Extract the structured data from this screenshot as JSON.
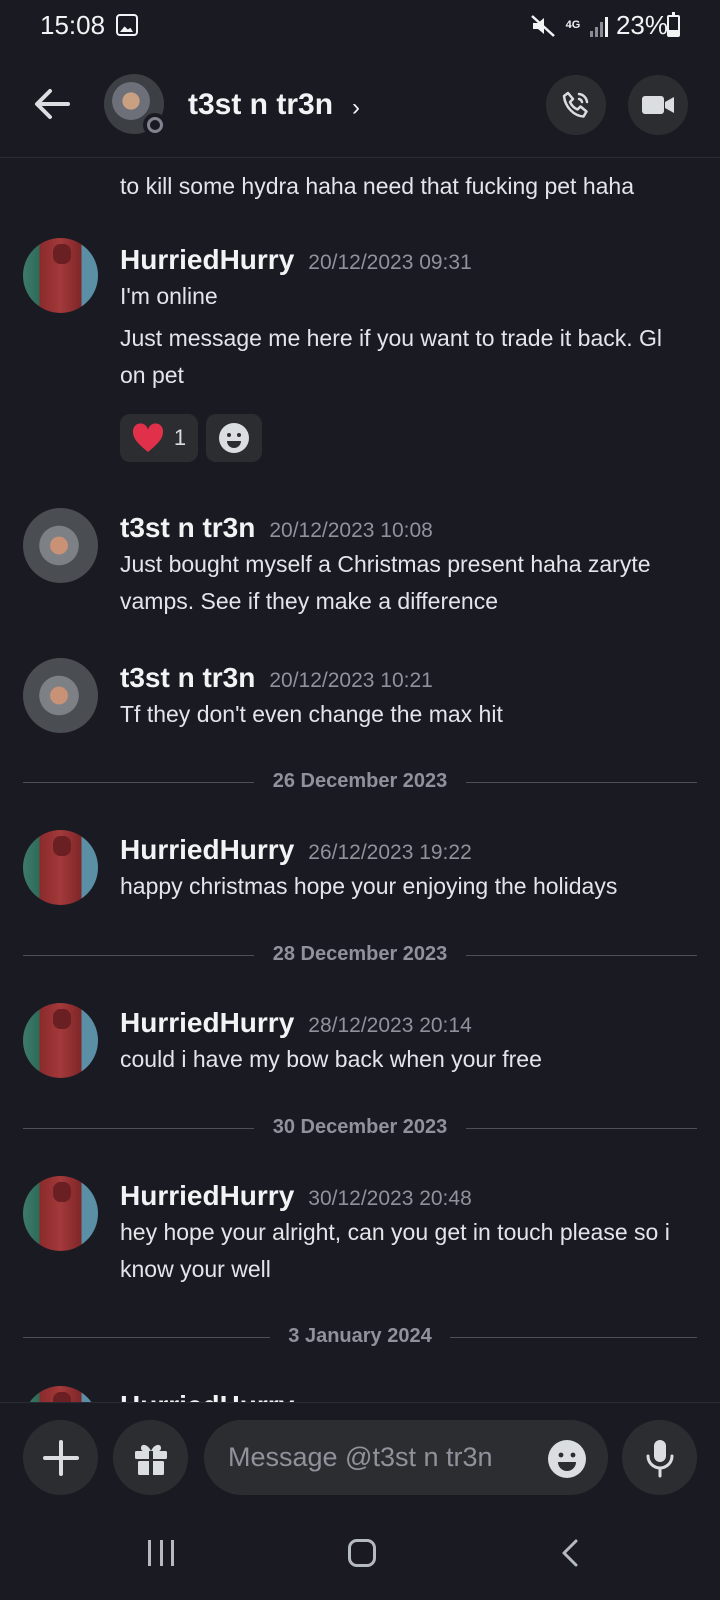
{
  "status_bar": {
    "time": "15:08",
    "network": "4G",
    "battery": "23%"
  },
  "header": {
    "title": "t3st n tr3n"
  },
  "messages": {
    "partial_top_text": "to kill some hydra haha need that fucking pet haha",
    "m1": {
      "author": "HurriedHurry",
      "time": "20/12/2023 09:31",
      "line1": "I'm online",
      "line2": "Just message me here if you want to trade it back. Gl on pet",
      "reaction_count": "1"
    },
    "m2": {
      "author": "t3st n tr3n",
      "time": "20/12/2023 10:08",
      "text": "Just bought myself a Christmas present haha zaryte vamps. See if they make a difference"
    },
    "m3": {
      "author": "t3st n tr3n",
      "time": "20/12/2023 10:21",
      "text": "Tf they don't even change the max hit"
    },
    "divider1": "26 December 2023",
    "m4": {
      "author": "HurriedHurry",
      "time": "26/12/2023 19:22",
      "text": "happy christmas hope your enjoying the holidays"
    },
    "divider2": "28 December 2023",
    "m5": {
      "author": "HurriedHurry",
      "time": "28/12/2023 20:14",
      "text": "could i have my bow back when your free"
    },
    "divider3": "30 December 2023",
    "m6": {
      "author": "HurriedHurry",
      "time": "30/12/2023 20:48",
      "text": "hey hope your alright, can you get in touch please so i know your well"
    },
    "divider4": "3 January 2024",
    "partial_bottom_author": "HurriedHurry"
  },
  "composer": {
    "placeholder": "Message @t3st n tr3n"
  },
  "colors": {
    "background": "#1a1b22",
    "surface": "#2b2d31",
    "heart": "#e0304a",
    "muted_text": "#8f929b"
  }
}
